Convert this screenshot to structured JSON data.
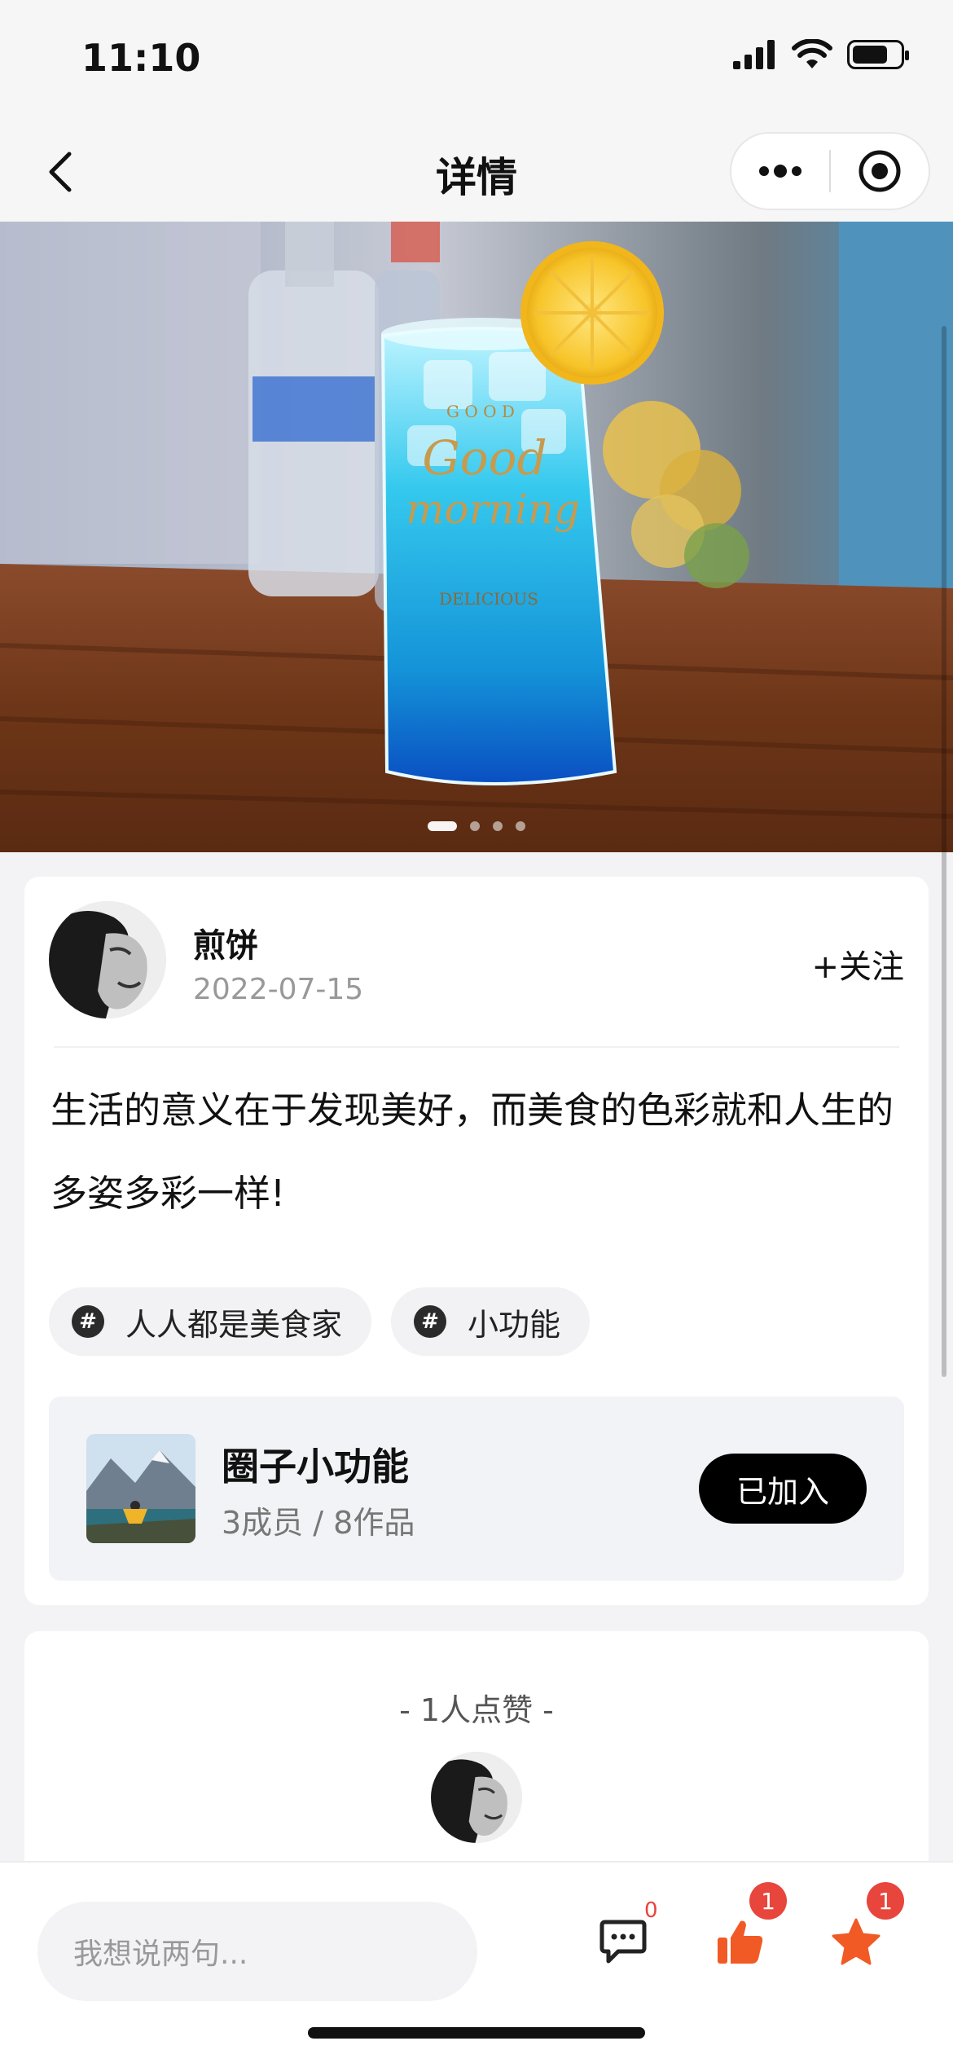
{
  "status_bar": {
    "time": "11:10"
  },
  "nav": {
    "title": "详情"
  },
  "hero": {
    "slide_count": 4,
    "active_slide": 1
  },
  "post": {
    "author": {
      "name": "煎饼"
    },
    "date": "2022-07-15",
    "follow_label": "+关注",
    "text": "生活的意义在于发现美好，而美食的色彩就和人生的多姿多彩一样!",
    "tags": [
      {
        "icon": "#",
        "label": "人人都是美食家"
      },
      {
        "icon": "#",
        "label": "小功能"
      }
    ],
    "circle": {
      "name": "圈子小功能",
      "stats": "3成员 / 8作品",
      "action_label": "已加入"
    }
  },
  "likes": {
    "title": "- 1人点赞 -"
  },
  "bottom_bar": {
    "comment_placeholder": "我想说两句...",
    "comment_count": "0",
    "like_count": "1",
    "favorite_count": "1"
  },
  "colors": {
    "accent": "#f15a24",
    "badge": "#e8453c"
  }
}
